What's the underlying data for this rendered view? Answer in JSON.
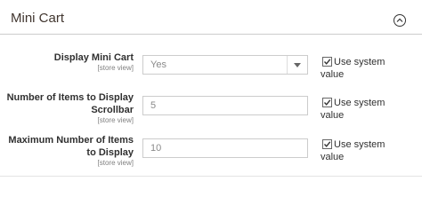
{
  "section": {
    "title": "Mini Cart",
    "collapse_icon": "chevron-up-circle-icon"
  },
  "rows": [
    {
      "label": "Display Mini Cart",
      "scope": "[store view]",
      "value": "Yes",
      "control": "select",
      "use_system": "Use system value",
      "checked": true
    },
    {
      "label": "Number of Items to Display Scrollbar",
      "scope": "[store view]",
      "value": "5",
      "control": "text",
      "use_system": "Use system value",
      "checked": true
    },
    {
      "label": "Maximum Number of Items to Display",
      "scope": "[store view]",
      "value": "10",
      "control": "text",
      "use_system": "Use system value",
      "checked": true
    }
  ]
}
